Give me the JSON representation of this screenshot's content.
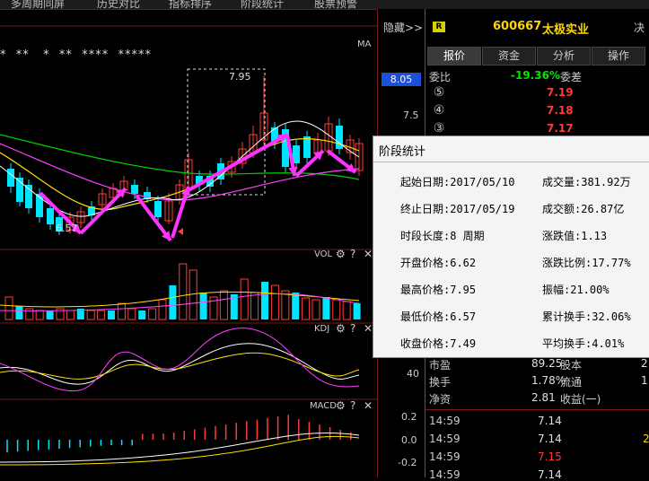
{
  "menu": {
    "items": [
      "多周期同屏",
      "历史对比",
      "指标排序",
      "阶段统计",
      "股票预警"
    ]
  },
  "toolbar": {
    "hide_label": "隐藏>>",
    "ma_label": "MA"
  },
  "main_chart": {
    "price_tag": "8.05",
    "axis_label_75": "7.5",
    "high_label": "7.95",
    "low_label": "6.57",
    "stars_text": "*  **   *  **  ****  *****"
  },
  "vol_panel": {
    "label": "VOL"
  },
  "kdj_panel": {
    "label": "KDJ",
    "axis": [
      "40"
    ]
  },
  "macd_panel": {
    "label": "MACD",
    "axis": [
      "0.2",
      "0.0",
      "-0.2"
    ]
  },
  "panel_icons": [
    "gear-icon",
    "question-icon",
    "close-icon"
  ],
  "quote": {
    "badge": "R",
    "code": "600667",
    "name": "太极实业",
    "decide": "决",
    "tabs": [
      "报价",
      "资金",
      "分析",
      "操作"
    ],
    "weibi_label": "委比",
    "weibi_value": "-19.36%",
    "weicha_label": "委差",
    "orders": [
      {
        "level": "⑤",
        "price": "7.19"
      },
      {
        "level": "④",
        "price": "7.18"
      },
      {
        "level": "③",
        "price": "7.17"
      }
    ],
    "stats": [
      {
        "label": "市盈",
        "value": "89.25",
        "label2": "股本",
        "value2": "2"
      },
      {
        "label": "换手",
        "value": "1.78%",
        "label2": "流通",
        "value2": "1"
      },
      {
        "label": "净资",
        "value": "2.81",
        "label2": "收益(一)",
        "value2": ""
      }
    ],
    "ticks": [
      {
        "time": "14:59",
        "price": "7.14",
        "color": "#e0e0e0",
        "extra": ""
      },
      {
        "time": "14:59",
        "price": "7.14",
        "color": "#e0e0e0",
        "extra": "2"
      },
      {
        "time": "14:59",
        "price": "7.15",
        "color": "#ff3b3b",
        "extra": ""
      },
      {
        "time": "14:59",
        "price": "7.14",
        "color": "#e0e0e0",
        "extra": ""
      }
    ],
    "axis_40": "40"
  },
  "popup": {
    "title": "阶段统计",
    "fields": [
      {
        "label": "起始日期:2017/05/10",
        "label2": "成交量:381.92万"
      },
      {
        "label": "终止日期:2017/05/19",
        "label2": "成交额:26.87亿"
      },
      {
        "label": "时段长度:8 周期",
        "label2": "涨跌值:1.13"
      },
      {
        "label": "开盘价格:6.62",
        "label2": "涨跌比例:17.77%"
      },
      {
        "label": "最高价格:7.95",
        "label2": "振幅:21.00%"
      },
      {
        "label": "最低价格:6.57",
        "label2": "累计换手:32.06%"
      },
      {
        "label": "收盘价格:7.49",
        "label2": "平均换手:4.01%"
      }
    ]
  },
  "colors": {
    "up": "#ff3b3b",
    "down": "#00e5ff",
    "ma_green": "#00d000",
    "ma_yellow": "#ffe000",
    "ma_magenta": "#ff40ff",
    "ma_white": "#ffffff",
    "arrow": "#ff33ff",
    "code": "#ffd400"
  }
}
